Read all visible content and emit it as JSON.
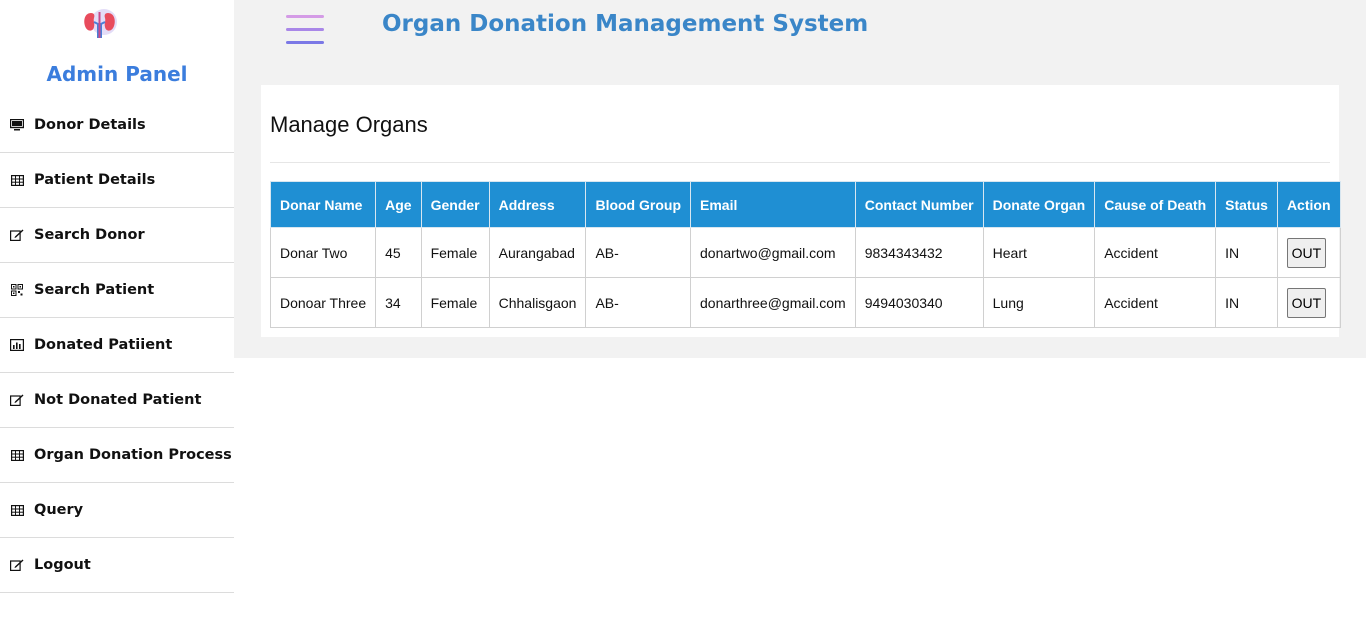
{
  "sidebar": {
    "panel_title": "Admin Panel",
    "items": [
      {
        "label": "Donor Details",
        "icon": "monitor-icon"
      },
      {
        "label": "Patient Details",
        "icon": "table-icon"
      },
      {
        "label": " Search Donor",
        "icon": "edit-icon"
      },
      {
        "label": "Search Patient",
        "icon": "qrcode-icon"
      },
      {
        "label": "Donated Patiient",
        "icon": "bar-chart-icon"
      },
      {
        "label": "Not Donated Patient",
        "icon": "edit-icon"
      },
      {
        "label": "Organ Donation Process",
        "icon": "table-icon"
      },
      {
        "label": "Query",
        "icon": "table-icon"
      },
      {
        "label": "Logout",
        "icon": "edit-icon"
      }
    ]
  },
  "header": {
    "title": "Organ Donation Management System",
    "title_color": "#3a86c8",
    "menu_icon": "hamburger-icon"
  },
  "card": {
    "title": "Manage Organs"
  },
  "table": {
    "header_color": "#1f8fd3",
    "columns": [
      "Donar Name",
      "Age",
      "Gender",
      "Address",
      "Blood Group",
      "Email",
      "Contact Number",
      "Donate Organ",
      "Cause of Death",
      "Status",
      "Action"
    ],
    "rows": [
      {
        "name": "Donar Two",
        "age": "45",
        "gender": "Female",
        "address": "Aurangabad",
        "blood_group": "AB-",
        "email": "donartwo@gmail.com",
        "contact": "9834343432",
        "organ": "Heart",
        "cause": "Accident",
        "status": "IN",
        "action": "OUT"
      },
      {
        "name": "Donoar Three",
        "age": "34",
        "gender": "Female",
        "address": "Chhalisgaon",
        "blood_group": "AB-",
        "email": "donarthree@gmail.com",
        "contact": "9494030340",
        "organ": "Lung",
        "cause": "Accident",
        "status": "IN",
        "action": "OUT"
      }
    ]
  }
}
